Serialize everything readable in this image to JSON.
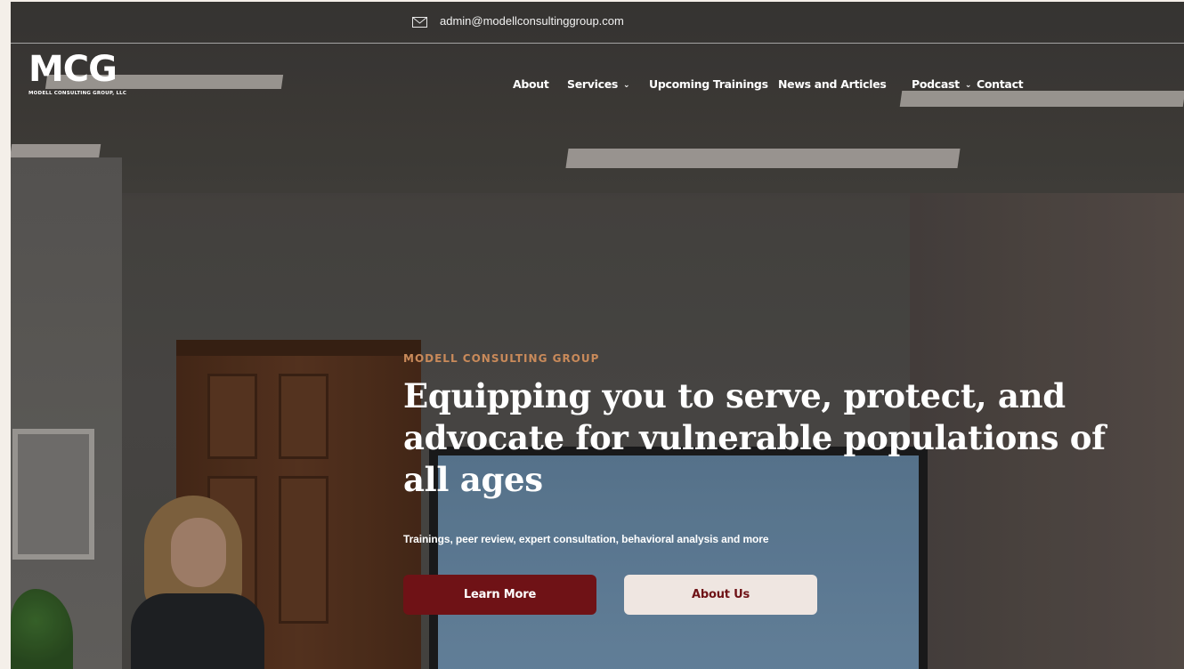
{
  "header": {
    "email": "admin@modellconsultinggroup.com",
    "logo": {
      "mark": "MCG",
      "subtitle": "MODELL CONSULTING GROUP, LLC"
    },
    "nav": [
      {
        "label": "About",
        "dropdown": false
      },
      {
        "label": "Services",
        "dropdown": true
      },
      {
        "label": "Upcoming Trainings",
        "dropdown": false
      },
      {
        "label": "News and Articles",
        "dropdown": false
      },
      {
        "label": "Podcast",
        "dropdown": true
      },
      {
        "label": "Contact",
        "dropdown": false
      }
    ]
  },
  "hero": {
    "eyebrow": "MODELL CONSULTING GROUP",
    "headline": "Equipping you to serve, protect, and advocate for vulnerable populations of all ages",
    "subline": "Trainings, peer review, expert consultation, behavioral analysis and more",
    "primary_button": "Learn More",
    "secondary_button": "About Us"
  },
  "colors": {
    "accent": "#6f1216",
    "eyebrow": "#c98a5a",
    "secondary_button_bg": "#efe6e1"
  },
  "icons": {
    "email": "envelope-icon",
    "dropdown": "chevron-down-icon"
  }
}
